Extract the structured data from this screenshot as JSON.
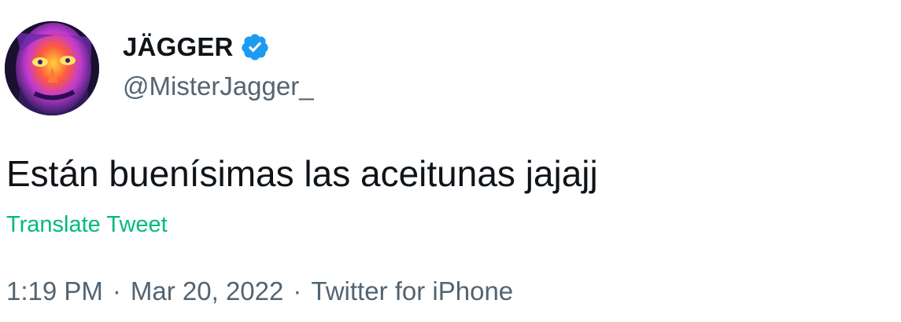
{
  "author": {
    "display_name": "JÄGGER",
    "handle": "@MisterJagger_",
    "verified": true,
    "verified_color": "#1d9bf0"
  },
  "tweet": {
    "text": "Están buenísimas las aceitunas jajajj",
    "translate_label": "Translate Tweet",
    "translate_color": "#00ba7c"
  },
  "meta": {
    "time": "1:19 PM",
    "separator": "·",
    "date": "Mar 20, 2022",
    "source": "Twitter for iPhone"
  },
  "icons": {
    "avatar": "avatar-photo",
    "verified": "verified-badge-icon"
  }
}
